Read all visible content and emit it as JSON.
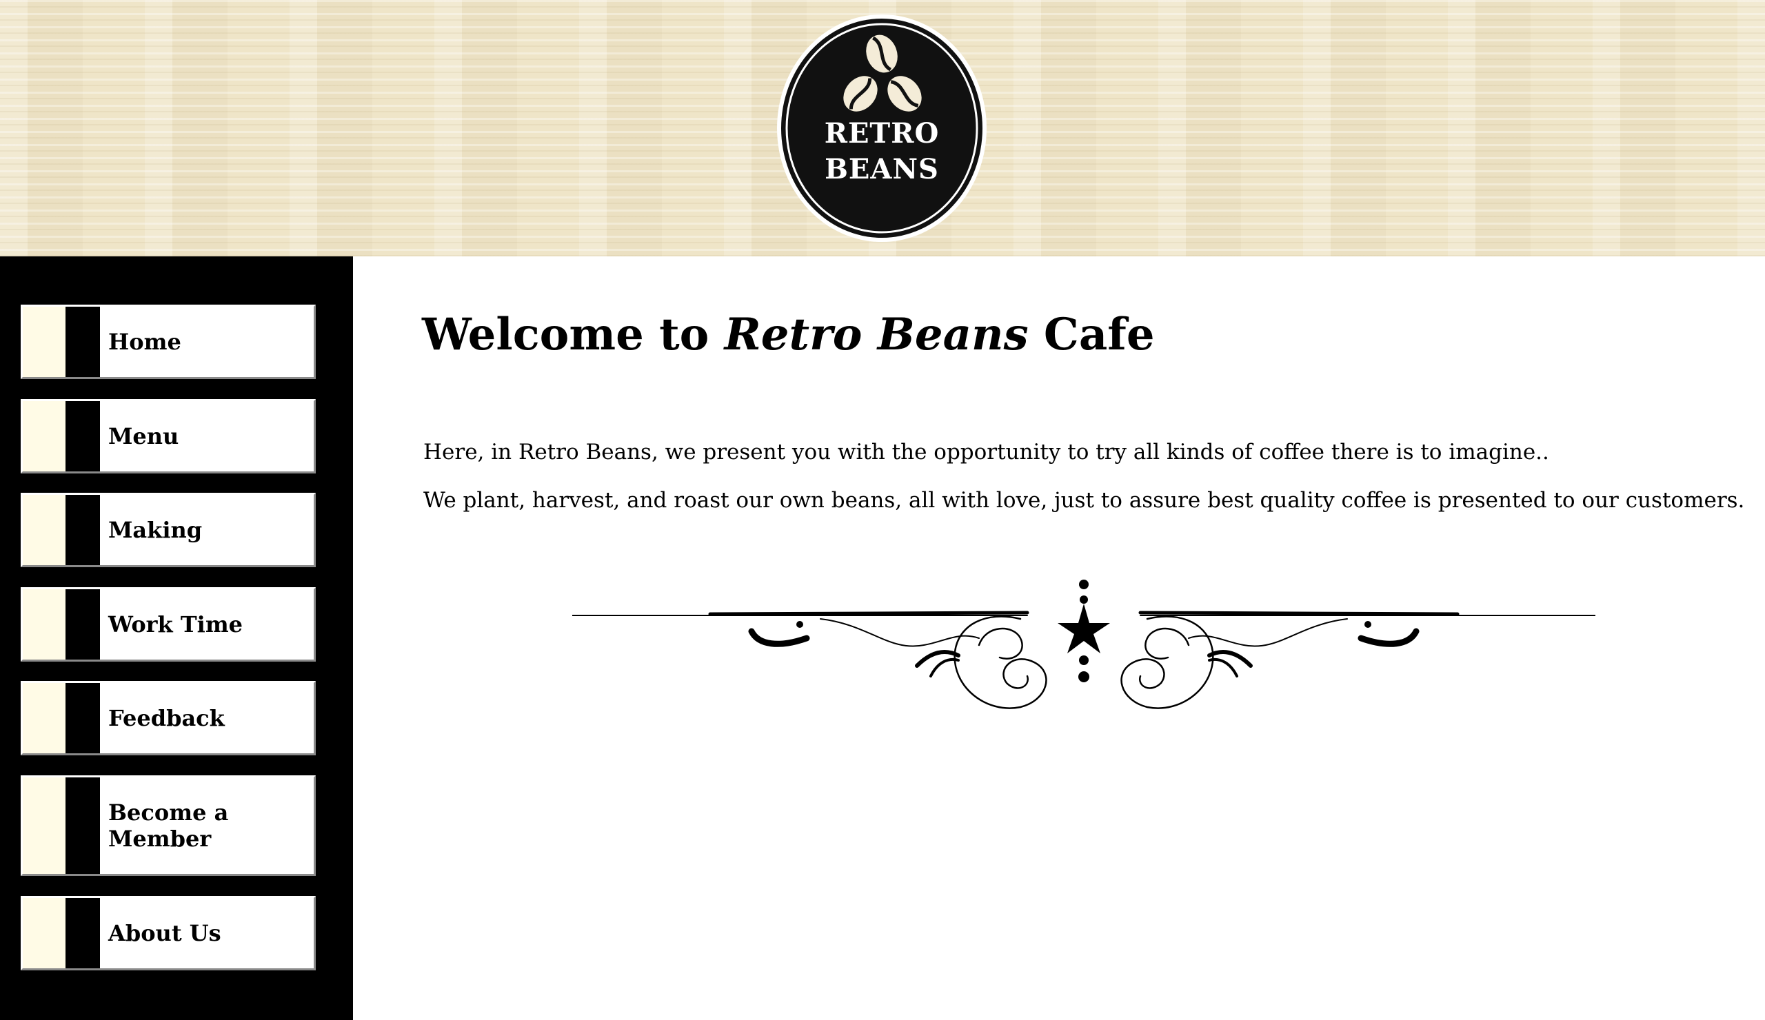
{
  "header": {
    "logo": {
      "line1": "RETRO",
      "line2": "BEANS",
      "icon": "coffee-beans-icon"
    }
  },
  "sidebar": {
    "items": [
      {
        "label": "Home"
      },
      {
        "label": "Menu"
      },
      {
        "label": "Making"
      },
      {
        "label": "Work Time"
      },
      {
        "label": "Feedback"
      },
      {
        "label": "Become a Member"
      },
      {
        "label": "About Us"
      }
    ]
  },
  "main": {
    "title_prefix": "Welcome to ",
    "title_em": "Retro Beans",
    "title_suffix": " Cafe",
    "paragraphs": [
      "Here, in Retro Beans, we present you with the opportunity to try all kinds of coffee there is to imagine..",
      "We plant, harvest, and roast our own beans, all with love, just to assure best quality coffee is presented to our customers."
    ],
    "ornament_icon": "flourish-divider-icon"
  },
  "colors": {
    "header_bg": "#efe5c8",
    "sidebar_bg": "#000000",
    "nav_cream": "#fffbe6",
    "logo_bg": "#111111"
  }
}
